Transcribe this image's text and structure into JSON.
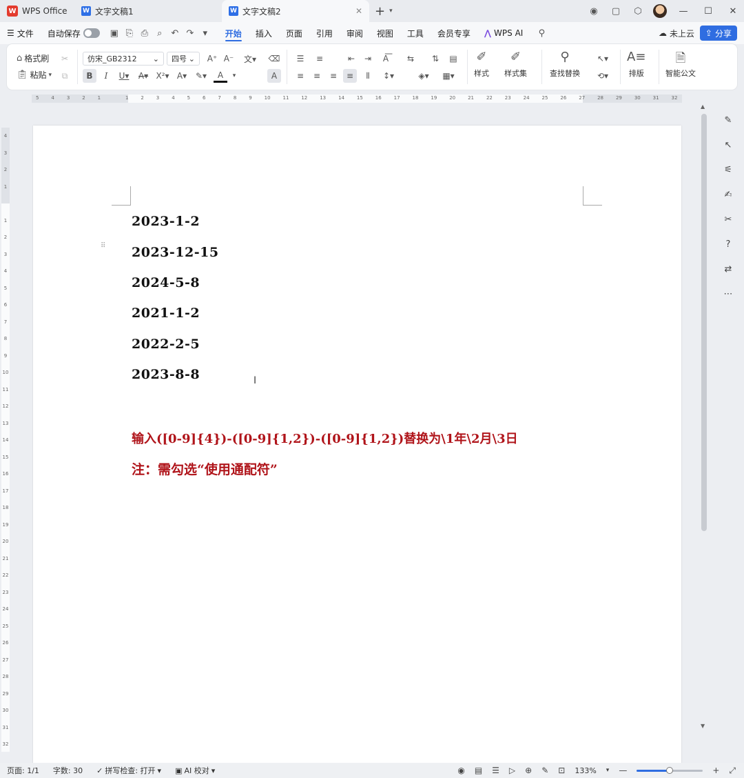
{
  "titlebar": {
    "tabs": [
      {
        "label": "WPS Office"
      },
      {
        "label": "文字文稿1"
      },
      {
        "label": "文字文稿2"
      }
    ],
    "new_tab": "+"
  },
  "menubar": {
    "file": "文件",
    "autosave": "自动保存",
    "menus": [
      "开始",
      "插入",
      "页面",
      "引用",
      "审阅",
      "视图",
      "工具",
      "会员专享"
    ],
    "active_menu": "开始",
    "wps_ai": "WPS AI",
    "cloud": "未上云",
    "share": "分享"
  },
  "ribbon": {
    "format_painter": "格式刷",
    "paste": "粘贴",
    "font_name": "仿宋_GB2312",
    "font_size": "四号",
    "styles": "样式",
    "style_set": "样式集",
    "find_replace": "查找替换",
    "arrange": "排版",
    "smart_doc": "智能公文"
  },
  "ruler": {
    "h_marks": [
      "5",
      "4",
      "3",
      "2",
      "1",
      "",
      "1",
      "2",
      "3",
      "4",
      "5",
      "6",
      "7",
      "8",
      "9",
      "10",
      "11",
      "12",
      "13",
      "14",
      "15",
      "16",
      "17",
      "18",
      "19",
      "20",
      "21",
      "22",
      "23",
      "24",
      "25",
      "26",
      "27",
      "28",
      "29",
      "30",
      "31",
      "32"
    ],
    "v_marks": [
      "4",
      "3",
      "2",
      "1",
      "",
      "1",
      "2",
      "3",
      "4",
      "5",
      "6",
      "7",
      "8",
      "9",
      "10",
      "11",
      "12",
      "13",
      "14",
      "15",
      "16",
      "17",
      "18",
      "19",
      "20",
      "21",
      "22",
      "23",
      "24",
      "25",
      "26",
      "27",
      "28",
      "29",
      "30",
      "31",
      "32"
    ]
  },
  "document": {
    "dates": [
      "2023-1-2",
      "2023-12-15",
      "2024-5-8",
      "2021-1-2",
      "2022-2-5",
      "2023-8-8"
    ],
    "instruction": "输入([0-9]{4})-([0-9]{1,2})-([0-9]{1,2})替换为\\1年\\2月\\3日",
    "note": "注：需勾选“使用通配符”"
  },
  "statusbar": {
    "page": "页面: 1/1",
    "word_count": "字数: 30",
    "spellcheck": "拼写检查: 打开",
    "ai_proof": "AI 校对",
    "zoom": "133%"
  },
  "zoom_fraction": 0.5,
  "colors": {
    "accent": "#2f6de1",
    "instruction_red": "#b0141a",
    "wps_red": "#e33b2e"
  }
}
